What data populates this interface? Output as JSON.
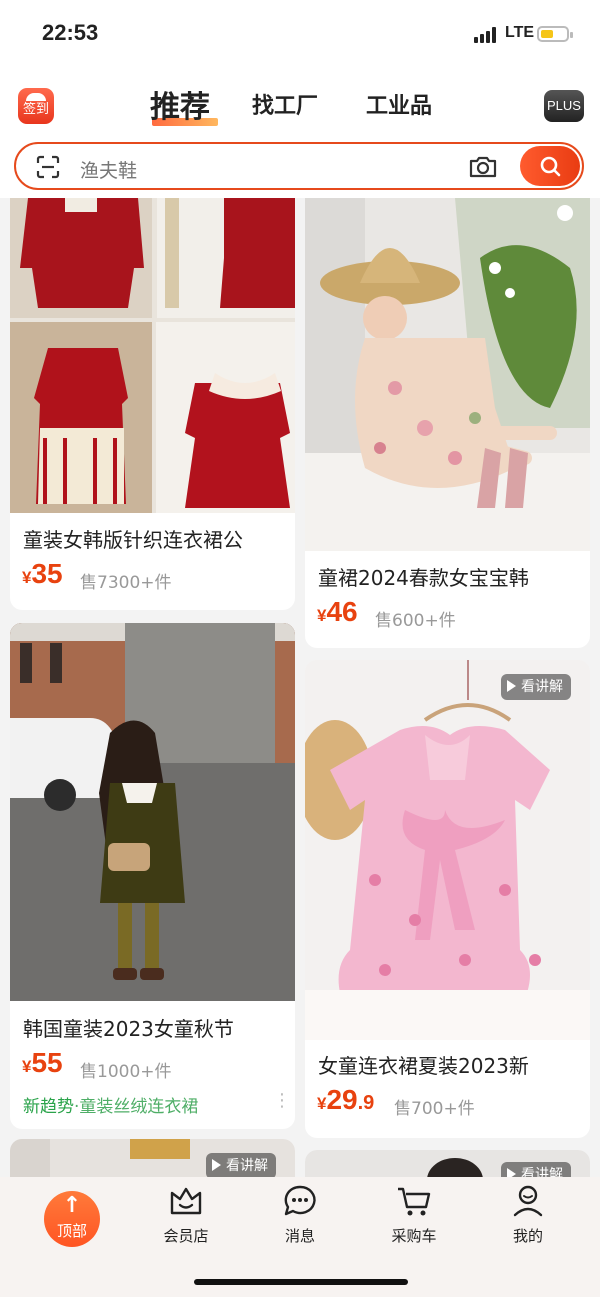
{
  "status_bar": {
    "time": "22:53",
    "network": "LTE"
  },
  "header": {
    "signin_label": "签到",
    "tabs": [
      {
        "label": "推荐",
        "active": true
      },
      {
        "label": "找工厂",
        "active": false
      },
      {
        "label": "工业品",
        "active": false
      }
    ],
    "plus_label": "PLUS"
  },
  "search": {
    "placeholder": "渔夫鞋",
    "icons": [
      "scan-icon",
      "camera-icon",
      "search-icon"
    ]
  },
  "products": [
    {
      "title": "童装女韩版针织连衣裙公",
      "currency": "¥",
      "price_int": "35",
      "price_dec": "",
      "sold": "售7300+件"
    },
    {
      "title": "童裙2024春款女宝宝韩",
      "currency": "¥",
      "price_int": "46",
      "price_dec": "",
      "sold": "售600+件"
    },
    {
      "title": "韩国童装2023女童秋节",
      "currency": "¥",
      "price_int": "55",
      "price_dec": "",
      "sold": "售1000+件",
      "trend_label": "新趋势",
      "trend_sep": "·",
      "trend_text": "童装丝绒连衣裙",
      "more": "⋮"
    },
    {
      "title": "女童连衣裙夏装2023新",
      "currency": "¥",
      "price_int": "29",
      "price_dec": ".9",
      "sold": "售700+件",
      "video_badge": "看讲解"
    },
    {
      "video_badge": "看讲解"
    },
    {
      "video_badge": "看讲解"
    }
  ],
  "bottom_nav": [
    {
      "label": "顶部",
      "icon": "arrow-up-icon"
    },
    {
      "label": "会员店",
      "icon": "member-store-icon"
    },
    {
      "label": "消息",
      "icon": "message-icon"
    },
    {
      "label": "采购车",
      "icon": "cart-icon"
    },
    {
      "label": "我的",
      "icon": "profile-icon"
    }
  ],
  "colors": {
    "accent": "#e8420f",
    "trend": "#2aa34a",
    "background": "#f3f3f3"
  }
}
